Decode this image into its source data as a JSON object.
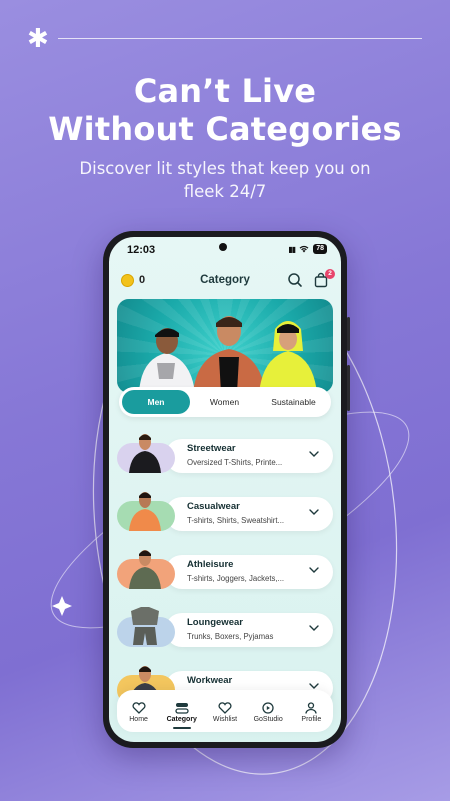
{
  "promo": {
    "headline_line1": "Can’t Live",
    "headline_line2": "Without Categories",
    "subline": "Discover lit styles that keep you on fleek 24/7"
  },
  "status": {
    "time": "12:03",
    "battery": "78"
  },
  "header": {
    "coins": "0",
    "title": "Category",
    "cart_badge": "2"
  },
  "segments": [
    {
      "label": "Men",
      "active": true
    },
    {
      "label": "Women",
      "active": false
    },
    {
      "label": "Sustainable",
      "active": false
    }
  ],
  "categories": [
    {
      "name": "Streetwear",
      "sub": "Oversized T-Shirts, Printe...",
      "thumb_color": "#d9d2ee"
    },
    {
      "name": "Casualwear",
      "sub": "T-shirts, Shirts, Sweatshirt...",
      "thumb_color": "#a6dcb2"
    },
    {
      "name": "Athleisure",
      "sub": "T-shirts, Joggers, Jackets,...",
      "thumb_color": "#f2a37a"
    },
    {
      "name": "Loungewear",
      "sub": "Trunks, Boxers, Pyjamas",
      "thumb_color": "#bcd3ea"
    },
    {
      "name": "Workwear",
      "sub": "",
      "thumb_color": "#f3c65e"
    }
  ],
  "tabbar": [
    {
      "label": "Home",
      "icon": "heart-icon",
      "active": false
    },
    {
      "label": "Category",
      "icon": "category-icon",
      "active": true
    },
    {
      "label": "Wishlist",
      "icon": "wishlist-heart-icon",
      "active": false
    },
    {
      "label": "GoStudio",
      "icon": "play-icon",
      "active": false
    },
    {
      "label": "Profile",
      "icon": "user-icon",
      "active": false
    }
  ],
  "colors": {
    "accent": "#1a9c9e",
    "background": "#8a7bd8",
    "badge": "#e8456b"
  }
}
